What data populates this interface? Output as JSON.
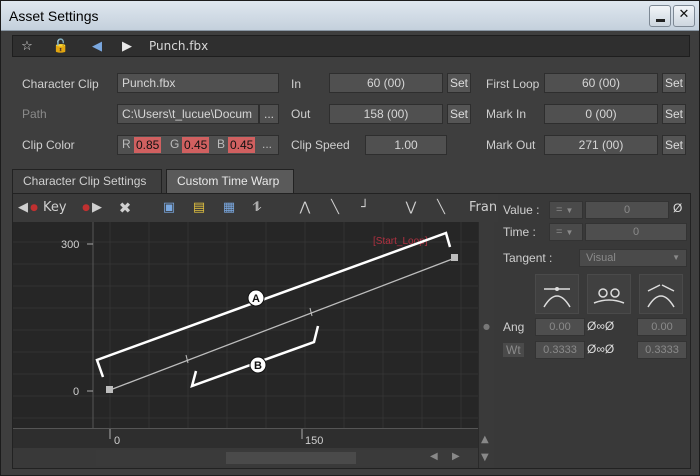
{
  "window": {
    "title": "Asset Settings"
  },
  "toolbar": {
    "filename": "Punch.fbx"
  },
  "form": {
    "character_clip_label": "Character Clip",
    "character_clip_value": "Punch.fbx",
    "path_label": "Path",
    "path_value": "C:\\Users\\t_lucue\\Docum",
    "path_more": "...",
    "clip_color_label": "Clip Color",
    "color_r_label": "R",
    "color_r": "0.85",
    "color_g_label": "G",
    "color_g": "0.45",
    "color_b_label": "B",
    "color_b": "0.45",
    "color_more": "...",
    "in_label": "In",
    "in_value": "60 (00)",
    "out_label": "Out",
    "out_value": "158 (00)",
    "clip_speed_label": "Clip Speed",
    "clip_speed_value": "1.00",
    "first_loop_label": "First Loop",
    "first_loop_value": "60 (00)",
    "mark_in_label": "Mark In",
    "mark_in_value": "0 (00)",
    "mark_out_label": "Mark Out",
    "mark_out_value": "271 (00)",
    "set_label": "Set"
  },
  "tabs": [
    {
      "label": "Character Clip Settings",
      "active": false
    },
    {
      "label": "Custom Time Warp",
      "active": true
    }
  ],
  "graph_toolbar": {
    "key_label": "Key",
    "frame_label": "Fran"
  },
  "graph": {
    "y_ticks": [
      "300",
      "0"
    ],
    "x_ticks": [
      "0",
      "150"
    ],
    "overlay_text": "[Start_Loop]",
    "callouts": [
      "A",
      "B"
    ],
    "line_color": "#bdbdbd",
    "callout_color": "#ffffff",
    "overlay_color": "#b03040"
  },
  "right_panel": {
    "value_label": "Value :",
    "value_mode": "=",
    "value": "0",
    "time_label": "Time :",
    "time_mode": "=",
    "time": "0",
    "tangent_label": "Tangent :",
    "tangent_value": "Visual",
    "ang_label": "Ang",
    "ang_left": "0.00",
    "ang_right": "0.00",
    "wt_label": "Wt",
    "wt_left": "0.3333",
    "wt_right": "0.3333"
  },
  "colors": {
    "accent_red": "#d06060",
    "panel_bg": "#393939",
    "graph_bg": "#262626"
  }
}
